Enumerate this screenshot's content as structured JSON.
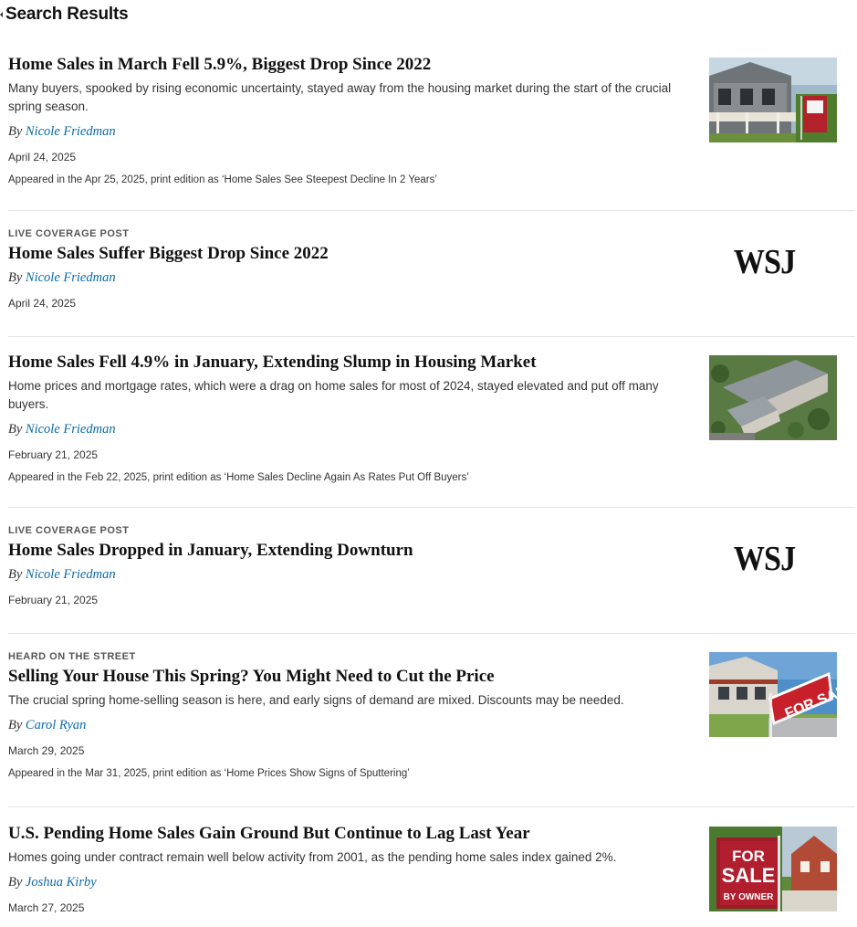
{
  "header": {
    "title": "Search Results"
  },
  "results": [
    {
      "flag": "",
      "title": "Home Sales in March Fell 5.9%, Biggest Drop Since 2022",
      "summary": "Many buyers, spooked by rising economic uncertainty, stayed away from the housing market during the start of the crucial spring season.",
      "by": "By",
      "author": "Nicole Friedman",
      "date": "April 24, 2025",
      "print": "Appeared in the Apr 25, 2025, print edition as ‘Home Sales See Steepest Decline In 2 Years’",
      "thumb": "house-for-sale-photo"
    },
    {
      "flag": "LIVE COVERAGE POST",
      "title": "Home Sales Suffer Biggest Drop Since 2022",
      "by": "By",
      "author": "Nicole Friedman",
      "date": "April 24, 2025",
      "logo": "WSJ"
    },
    {
      "flag": "",
      "title": "Home Sales Fell 4.9% in January, Extending Slump in Housing Market",
      "summary": "Home prices and mortgage rates, which were a drag on home sales for most of 2024, stayed elevated and put off many buyers.",
      "by": "By",
      "author": "Nicole Friedman",
      "date": "February 21, 2025",
      "print": "Appeared in the Feb 22, 2025, print edition as ‘Home Sales Decline Again As Rates Put Off Buyers’",
      "thumb": "aerial-townhouses-photo"
    },
    {
      "flag": "LIVE COVERAGE POST",
      "title": "Home Sales Dropped in January, Extending Downturn",
      "by": "By",
      "author": "Nicole Friedman",
      "date": "February 21, 2025",
      "logo": "WSJ"
    },
    {
      "flag": "HEARD ON THE STREET",
      "title": "Selling Your House This Spring? You Might Need to Cut the Price",
      "summary": "The crucial spring home-selling season is here, and early signs of demand are mixed. Discounts may be needed.",
      "by": "By",
      "author": "Carol Ryan",
      "date": "March 29, 2025",
      "print": "Appeared in the Mar 31, 2025, print edition as ‘Home Prices Show Signs of Sputtering’",
      "thumb": "for-sale-sign-photo"
    },
    {
      "flag": "",
      "title": "U.S. Pending Home Sales Gain Ground But Continue to Lag Last Year",
      "summary": "Homes going under contract remain well below activity from 2001, as the pending home sales index gained 2%.",
      "by": "By",
      "author": "Joshua Kirby",
      "date": "March 27, 2025",
      "thumb": "for-sale-by-owner-photo",
      "sign_text": [
        "FOR",
        "SALE",
        "BY OWNER"
      ]
    }
  ],
  "photo4_sign": "FOR SALE",
  "colors": {
    "link": "#0b6aa8",
    "divider": "#e4e4e4"
  }
}
